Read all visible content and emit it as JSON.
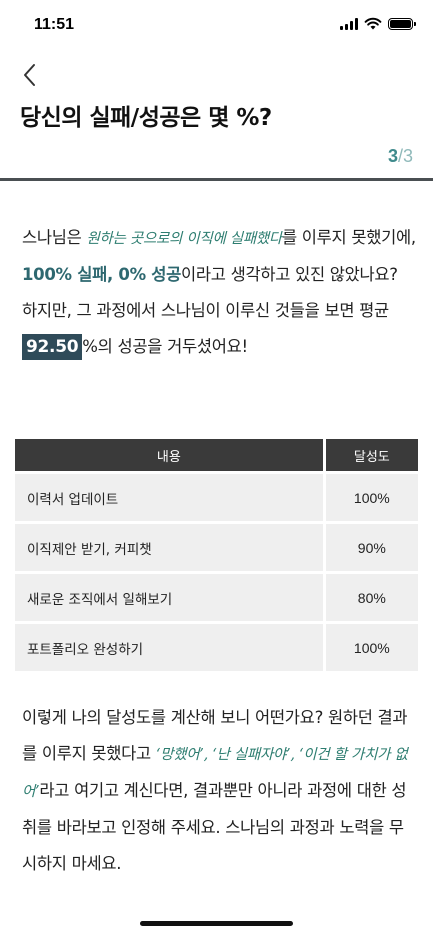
{
  "status_bar": {
    "time": "11:51"
  },
  "header": {
    "title": "당신의 실패/성공은 몇 %?",
    "page_current": "3",
    "page_total": "/3"
  },
  "intro": {
    "p1": "스나님은 ",
    "goal": "원하는 곳으로의 이직에 실패했다",
    "p2": "를 이루지 못했기에, ",
    "strong": "100% 실패, 0% 성공",
    "p3": "이라고 생각하고 있진 않았나요? 하지만, 그 과정에서 스나님이 이루신 것들을 보면 평균 ",
    "average": "92.50",
    "p4": "%의 성공을 거두셨어요!"
  },
  "table": {
    "header_content": "내용",
    "header_rate": "달성도",
    "rows": [
      {
        "content": "이력서 업데이트",
        "rate": "100%"
      },
      {
        "content": "이직제안 받기, 커피챗",
        "rate": "90%"
      },
      {
        "content": "새로운 조직에서 일해보기",
        "rate": "80%"
      },
      {
        "content": "포트폴리오 완성하기",
        "rate": "100%"
      }
    ]
  },
  "outro": {
    "p1": "이렇게 나의 달성도를 계산해 보니 어떤가요? 원하던 결과를 이루지 못했다고 ",
    "q1": "‘망했어’, ‘난 실패자야’, ‘이건 할 가치가 없어’",
    "p2": "라고 여기고 계신다면, 결과뿐만 아니라 과정에 대한 성취를 바라보고 인정해 주세요. 스나님의 과정과 노력을 무시하지 마세요."
  }
}
